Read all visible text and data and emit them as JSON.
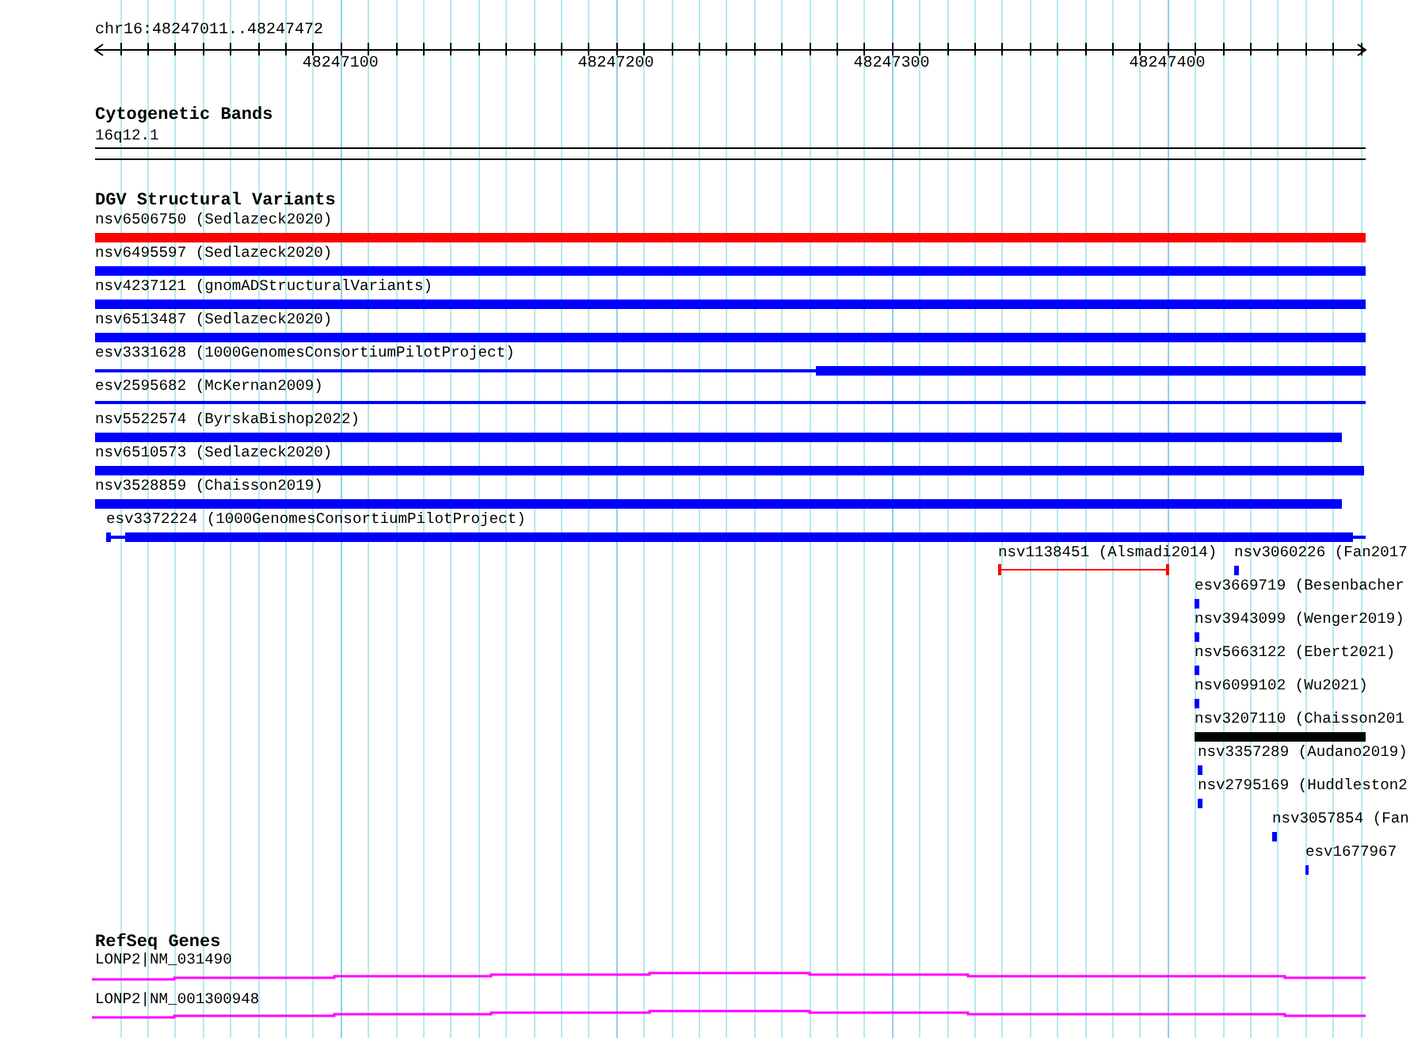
{
  "ruler": {
    "region": "chr16:48247011..48247472",
    "ticks": [
      "48247100",
      "48247200",
      "48247300",
      "48247400"
    ]
  },
  "tracks": [
    {
      "title": "Cytogenetic Bands",
      "features": [
        {
          "label": "16q12.1",
          "kind": "band",
          "color": "#000000"
        }
      ]
    },
    {
      "title": "DGV Structural Variants",
      "features": [
        {
          "label": "nsv6506750 (Sedlazeck2020)",
          "kind": "bar",
          "color": "#ff0000"
        },
        {
          "label": "nsv6495597 (Sedlazeck2020)",
          "kind": "bar",
          "color": "#0000ff"
        },
        {
          "label": "nsv4237121 (gnomADStructuralVariants)",
          "kind": "bar",
          "color": "#0000ff"
        },
        {
          "label": "nsv6513487 (Sedlazeck2020)",
          "kind": "bar",
          "color": "#0000ff"
        },
        {
          "label": "esv3331628 (1000GenomesConsortiumPilotProject)",
          "kind": "split",
          "color": "#0000ff"
        },
        {
          "label": "esv2595682 (McKernan2009)",
          "kind": "line",
          "color": "#0000ff"
        },
        {
          "label": "nsv5522574 (ByrskaBishop2022)",
          "kind": "bar",
          "color": "#0000ff"
        },
        {
          "label": "nsv6510573 (Sedlazeck2020)",
          "kind": "bar",
          "color": "#0000ff"
        },
        {
          "label": "nsv3528859 (Chaisson2019)",
          "kind": "bar",
          "color": "#0000ff"
        },
        {
          "label": "esv3372224 (1000GenomesConsortiumPilotProject)",
          "kind": "split",
          "color": "#0000ff"
        },
        {
          "label": "nsv1138451 (Alsmadi2014)",
          "kind": "span",
          "color": "#ff0000"
        },
        {
          "label": "nsv3060226 (Fan2017",
          "kind": "bar",
          "color": "#0000ff"
        },
        {
          "label": "esv3669719 (Besenbacher",
          "kind": "bar",
          "color": "#0000ff"
        },
        {
          "label": "nsv3943099 (Wenger2019)",
          "kind": "bar",
          "color": "#0000ff"
        },
        {
          "label": "nsv5663122 (Ebert2021)",
          "kind": "bar",
          "color": "#0000ff"
        },
        {
          "label": "nsv6099102 (Wu2021)",
          "kind": "bar",
          "color": "#0000ff"
        },
        {
          "label": "nsv3207110 (Chaisson201",
          "kind": "bar",
          "color": "#000000"
        },
        {
          "label": "nsv3357289 (Audano2019)",
          "kind": "bar",
          "color": "#0000ff"
        },
        {
          "label": "nsv2795169 (Huddleston2",
          "kind": "bar",
          "color": "#0000ff"
        },
        {
          "label": "nsv3057854 (Fan",
          "kind": "bar",
          "color": "#0000ff"
        },
        {
          "label": "esv1677967",
          "kind": "bar",
          "color": "#0000ff"
        }
      ]
    },
    {
      "title": "RefSeq Genes",
      "features": [
        {
          "label": "LONP2|NM_031490",
          "kind": "transcript",
          "color": "#ff00ff"
        },
        {
          "label": "LONP2|NM_001300948",
          "kind": "transcript",
          "color": "#ff00ff"
        }
      ]
    }
  ]
}
